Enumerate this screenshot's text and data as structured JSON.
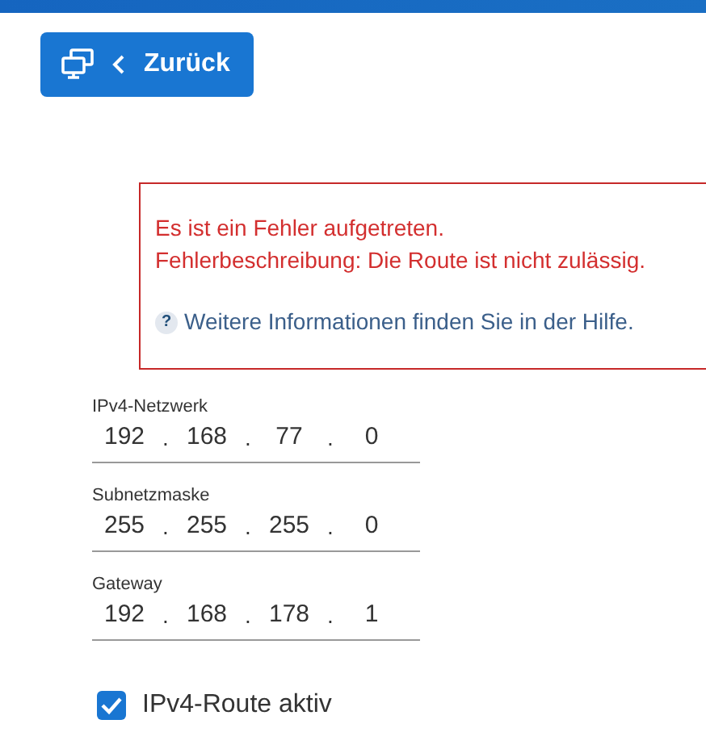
{
  "back_button": {
    "label": "Zurück"
  },
  "error": {
    "lines": [
      "Es ist ein Fehler aufgetreten.",
      "Fehlerbeschreibung: Die Route ist nicht zulässig."
    ],
    "help_icon": "?",
    "help_text": "Weitere Informationen finden Sie in der Hilfe."
  },
  "fields": [
    {
      "label": "IPv4-Netzwerk",
      "octets": [
        "192",
        "168",
        "77",
        "0"
      ]
    },
    {
      "label": "Subnetzmaske",
      "octets": [
        "255",
        "255",
        "255",
        "0"
      ]
    },
    {
      "label": "Gateway",
      "octets": [
        "192",
        "168",
        "178",
        "1"
      ]
    }
  ],
  "separator": ".",
  "route_active": {
    "label": "IPv4-Route aktiv",
    "checked": true
  }
}
